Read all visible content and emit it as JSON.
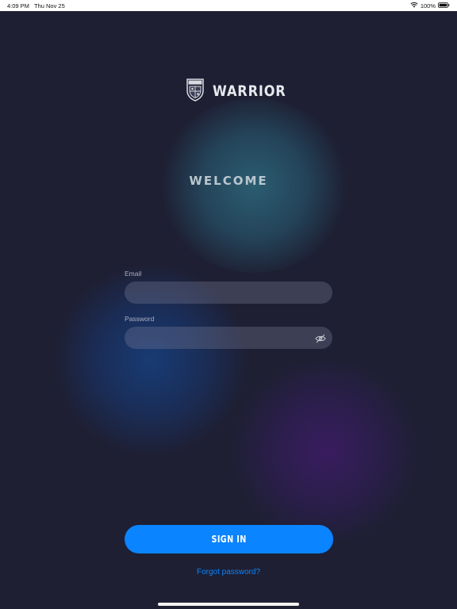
{
  "status_bar": {
    "time": "4:09 PM",
    "date": "Thu Nov 25",
    "battery": "100%",
    "icons": [
      "wifi-icon",
      "battery-icon"
    ]
  },
  "brand": {
    "name": "WARRIOR",
    "logo_icon": "crest-shield-icon"
  },
  "welcome": "WELCOME",
  "form": {
    "email_label": "Email",
    "email_value": "",
    "password_label": "Password",
    "password_value": "",
    "password_toggle_icon": "eye-slash-icon"
  },
  "actions": {
    "sign_in_label": "SIGN IN",
    "forgot_password_label": "Forgot password?"
  },
  "colors": {
    "background": "#1e1f33",
    "accent": "#0a84ff",
    "input_fill": "#4a4d66",
    "label_text": "#aeb1c0"
  }
}
